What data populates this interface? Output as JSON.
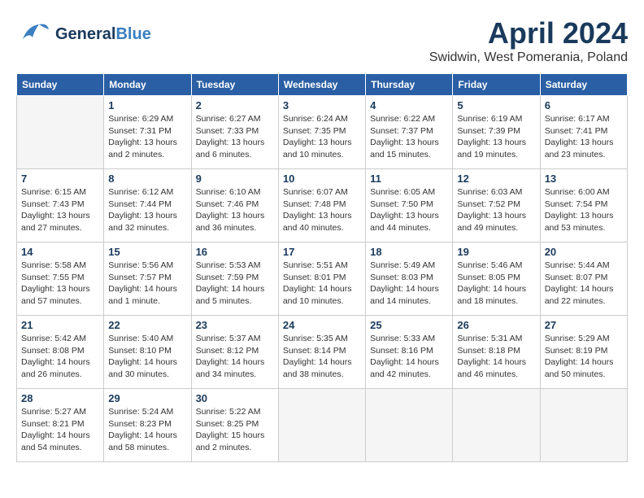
{
  "header": {
    "logo_general": "General",
    "logo_blue": "Blue",
    "title": "April 2024",
    "subtitle": "Swidwin, West Pomerania, Poland"
  },
  "weekdays": [
    "Sunday",
    "Monday",
    "Tuesday",
    "Wednesday",
    "Thursday",
    "Friday",
    "Saturday"
  ],
  "weeks": [
    [
      {
        "day": "",
        "sunrise": "",
        "sunset": "",
        "daylight": ""
      },
      {
        "day": "1",
        "sunrise": "Sunrise: 6:29 AM",
        "sunset": "Sunset: 7:31 PM",
        "daylight": "Daylight: 13 hours and 2 minutes."
      },
      {
        "day": "2",
        "sunrise": "Sunrise: 6:27 AM",
        "sunset": "Sunset: 7:33 PM",
        "daylight": "Daylight: 13 hours and 6 minutes."
      },
      {
        "day": "3",
        "sunrise": "Sunrise: 6:24 AM",
        "sunset": "Sunset: 7:35 PM",
        "daylight": "Daylight: 13 hours and 10 minutes."
      },
      {
        "day": "4",
        "sunrise": "Sunrise: 6:22 AM",
        "sunset": "Sunset: 7:37 PM",
        "daylight": "Daylight: 13 hours and 15 minutes."
      },
      {
        "day": "5",
        "sunrise": "Sunrise: 6:19 AM",
        "sunset": "Sunset: 7:39 PM",
        "daylight": "Daylight: 13 hours and 19 minutes."
      },
      {
        "day": "6",
        "sunrise": "Sunrise: 6:17 AM",
        "sunset": "Sunset: 7:41 PM",
        "daylight": "Daylight: 13 hours and 23 minutes."
      }
    ],
    [
      {
        "day": "7",
        "sunrise": "Sunrise: 6:15 AM",
        "sunset": "Sunset: 7:43 PM",
        "daylight": "Daylight: 13 hours and 27 minutes."
      },
      {
        "day": "8",
        "sunrise": "Sunrise: 6:12 AM",
        "sunset": "Sunset: 7:44 PM",
        "daylight": "Daylight: 13 hours and 32 minutes."
      },
      {
        "day": "9",
        "sunrise": "Sunrise: 6:10 AM",
        "sunset": "Sunset: 7:46 PM",
        "daylight": "Daylight: 13 hours and 36 minutes."
      },
      {
        "day": "10",
        "sunrise": "Sunrise: 6:07 AM",
        "sunset": "Sunset: 7:48 PM",
        "daylight": "Daylight: 13 hours and 40 minutes."
      },
      {
        "day": "11",
        "sunrise": "Sunrise: 6:05 AM",
        "sunset": "Sunset: 7:50 PM",
        "daylight": "Daylight: 13 hours and 44 minutes."
      },
      {
        "day": "12",
        "sunrise": "Sunrise: 6:03 AM",
        "sunset": "Sunset: 7:52 PM",
        "daylight": "Daylight: 13 hours and 49 minutes."
      },
      {
        "day": "13",
        "sunrise": "Sunrise: 6:00 AM",
        "sunset": "Sunset: 7:54 PM",
        "daylight": "Daylight: 13 hours and 53 minutes."
      }
    ],
    [
      {
        "day": "14",
        "sunrise": "Sunrise: 5:58 AM",
        "sunset": "Sunset: 7:55 PM",
        "daylight": "Daylight: 13 hours and 57 minutes."
      },
      {
        "day": "15",
        "sunrise": "Sunrise: 5:56 AM",
        "sunset": "Sunset: 7:57 PM",
        "daylight": "Daylight: 14 hours and 1 minute."
      },
      {
        "day": "16",
        "sunrise": "Sunrise: 5:53 AM",
        "sunset": "Sunset: 7:59 PM",
        "daylight": "Daylight: 14 hours and 5 minutes."
      },
      {
        "day": "17",
        "sunrise": "Sunrise: 5:51 AM",
        "sunset": "Sunset: 8:01 PM",
        "daylight": "Daylight: 14 hours and 10 minutes."
      },
      {
        "day": "18",
        "sunrise": "Sunrise: 5:49 AM",
        "sunset": "Sunset: 8:03 PM",
        "daylight": "Daylight: 14 hours and 14 minutes."
      },
      {
        "day": "19",
        "sunrise": "Sunrise: 5:46 AM",
        "sunset": "Sunset: 8:05 PM",
        "daylight": "Daylight: 14 hours and 18 minutes."
      },
      {
        "day": "20",
        "sunrise": "Sunrise: 5:44 AM",
        "sunset": "Sunset: 8:07 PM",
        "daylight": "Daylight: 14 hours and 22 minutes."
      }
    ],
    [
      {
        "day": "21",
        "sunrise": "Sunrise: 5:42 AM",
        "sunset": "Sunset: 8:08 PM",
        "daylight": "Daylight: 14 hours and 26 minutes."
      },
      {
        "day": "22",
        "sunrise": "Sunrise: 5:40 AM",
        "sunset": "Sunset: 8:10 PM",
        "daylight": "Daylight: 14 hours and 30 minutes."
      },
      {
        "day": "23",
        "sunrise": "Sunrise: 5:37 AM",
        "sunset": "Sunset: 8:12 PM",
        "daylight": "Daylight: 14 hours and 34 minutes."
      },
      {
        "day": "24",
        "sunrise": "Sunrise: 5:35 AM",
        "sunset": "Sunset: 8:14 PM",
        "daylight": "Daylight: 14 hours and 38 minutes."
      },
      {
        "day": "25",
        "sunrise": "Sunrise: 5:33 AM",
        "sunset": "Sunset: 8:16 PM",
        "daylight": "Daylight: 14 hours and 42 minutes."
      },
      {
        "day": "26",
        "sunrise": "Sunrise: 5:31 AM",
        "sunset": "Sunset: 8:18 PM",
        "daylight": "Daylight: 14 hours and 46 minutes."
      },
      {
        "day": "27",
        "sunrise": "Sunrise: 5:29 AM",
        "sunset": "Sunset: 8:19 PM",
        "daylight": "Daylight: 14 hours and 50 minutes."
      }
    ],
    [
      {
        "day": "28",
        "sunrise": "Sunrise: 5:27 AM",
        "sunset": "Sunset: 8:21 PM",
        "daylight": "Daylight: 14 hours and 54 minutes."
      },
      {
        "day": "29",
        "sunrise": "Sunrise: 5:24 AM",
        "sunset": "Sunset: 8:23 PM",
        "daylight": "Daylight: 14 hours and 58 minutes."
      },
      {
        "day": "30",
        "sunrise": "Sunrise: 5:22 AM",
        "sunset": "Sunset: 8:25 PM",
        "daylight": "Daylight: 15 hours and 2 minutes."
      },
      {
        "day": "",
        "sunrise": "",
        "sunset": "",
        "daylight": ""
      },
      {
        "day": "",
        "sunrise": "",
        "sunset": "",
        "daylight": ""
      },
      {
        "day": "",
        "sunrise": "",
        "sunset": "",
        "daylight": ""
      },
      {
        "day": "",
        "sunrise": "",
        "sunset": "",
        "daylight": ""
      }
    ]
  ]
}
